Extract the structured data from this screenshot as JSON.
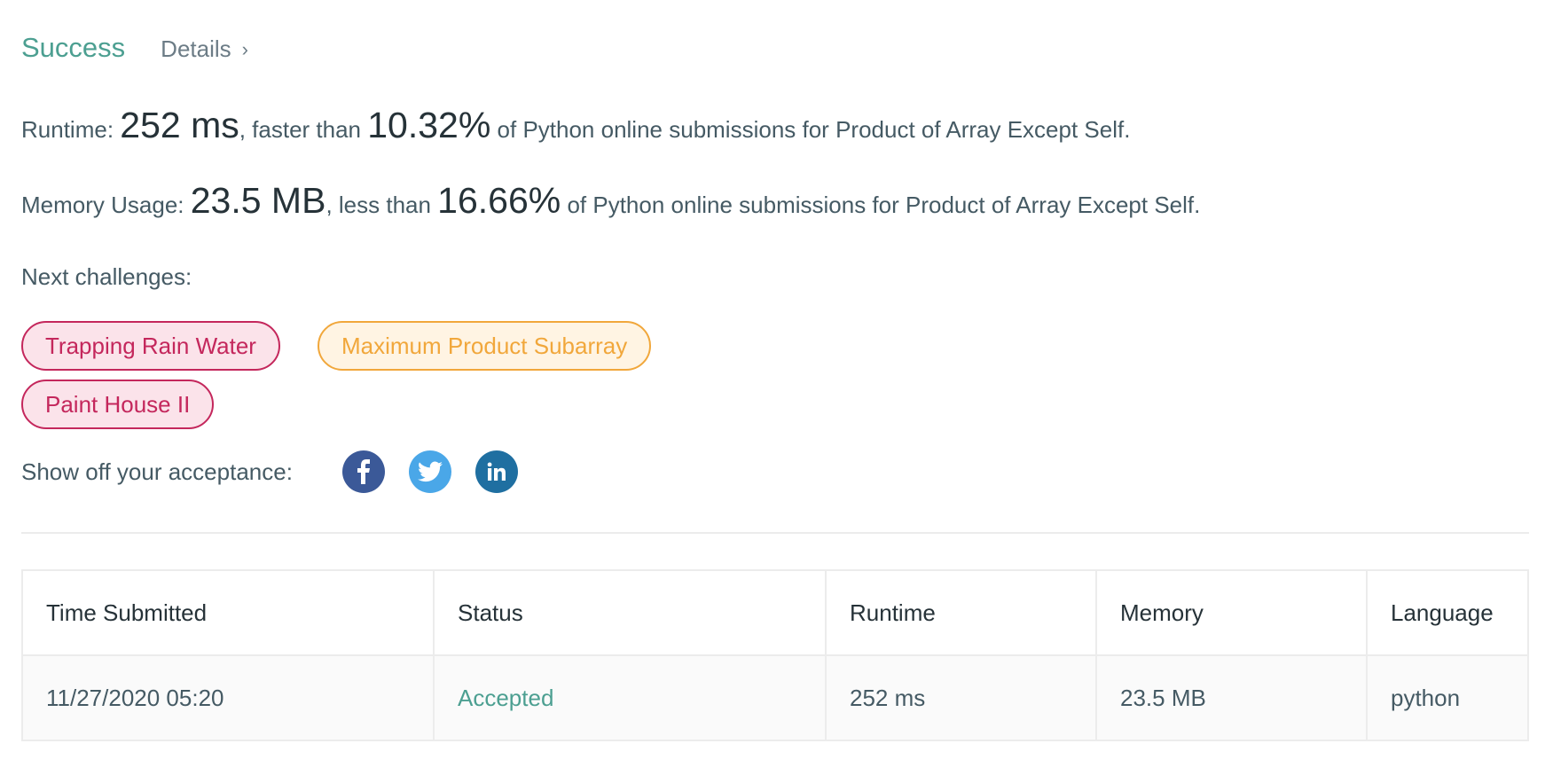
{
  "header": {
    "status": "Success",
    "details_label": "Details",
    "details_chevron": "›"
  },
  "runtime": {
    "label": "Runtime: ",
    "value": "252 ms",
    "comparator": ", faster than ",
    "percent": "10.32%",
    "suffix": " of Python online submissions for Product of Array Except Self."
  },
  "memory": {
    "label": "Memory Usage: ",
    "value": "23.5 MB",
    "comparator": ", less than ",
    "percent": "16.66%",
    "suffix": " of Python online submissions for Product of Array Except Self."
  },
  "next_challenges": {
    "label": "Next challenges:",
    "items": [
      {
        "label": "Trapping Rain Water",
        "difficulty": "hard"
      },
      {
        "label": "Maximum Product Subarray",
        "difficulty": "medium"
      },
      {
        "label": "Paint House II",
        "difficulty": "hard"
      }
    ]
  },
  "share": {
    "label": "Show off your acceptance:",
    "icons": [
      "facebook-icon",
      "twitter-icon",
      "linkedin-icon"
    ]
  },
  "table": {
    "headers": [
      "Time Submitted",
      "Status",
      "Runtime",
      "Memory",
      "Language"
    ],
    "rows": [
      [
        "11/27/2020 05:20",
        "Accepted",
        "252 ms",
        "23.5 MB",
        "python"
      ]
    ]
  },
  "colors": {
    "success": "#4c9f91",
    "hard": "#c4275c",
    "medium": "#f1a73b",
    "facebook": "#3b5998",
    "twitter": "#4aa7e8",
    "linkedin": "#1f6fa1"
  }
}
